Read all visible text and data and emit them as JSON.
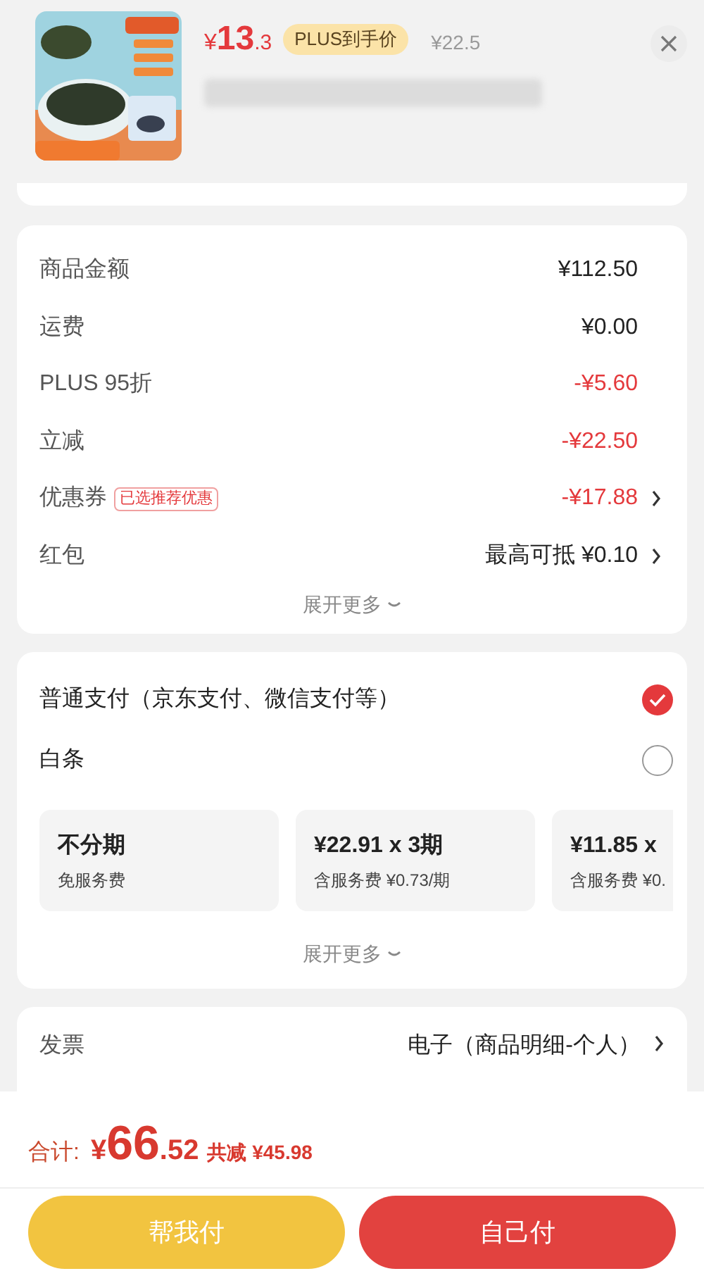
{
  "product": {
    "currency": "¥",
    "price_int": "13",
    "price_dec": ".3",
    "badge": "PLUS到手价",
    "original_price": "¥22.5"
  },
  "summary": {
    "rows": [
      {
        "label": "商品金额",
        "value": "¥112.50",
        "discount": false,
        "arrow": false
      },
      {
        "label": "运费",
        "value": "¥0.00",
        "discount": false,
        "arrow": false
      },
      {
        "label": "PLUS 95折",
        "value": "-¥5.60",
        "discount": true,
        "arrow": false
      },
      {
        "label": "立减",
        "value": "-¥22.50",
        "discount": true,
        "arrow": false
      },
      {
        "label": "优惠券",
        "tag": "已选推荐优惠",
        "value": "-¥17.88",
        "discount": true,
        "arrow": true
      },
      {
        "label": "红包",
        "value": "最高可抵 ¥0.10",
        "discount": false,
        "arrow": true
      }
    ],
    "expand": "展开更多"
  },
  "payment": {
    "options": [
      {
        "label": "普通支付（京东支付、微信支付等）",
        "selected": true
      },
      {
        "label": "白条",
        "selected": false
      }
    ],
    "installments": [
      {
        "title": "不分期",
        "subtitle": "免服务费"
      },
      {
        "title": "¥22.91 x 3期",
        "subtitle": "含服务费 ¥0.73/期"
      },
      {
        "title": "¥11.85 x",
        "subtitle": "含服务费 ¥0."
      }
    ],
    "expand": "展开更多"
  },
  "invoice": {
    "label": "发票",
    "value": "电子（商品明细-个人）"
  },
  "footer": {
    "total_label": "合计:",
    "currency": "¥",
    "total_int": "66",
    "total_dec": ".52",
    "saved": "共减 ¥45.98",
    "buttons": [
      {
        "label": "帮我付",
        "kind": "secondary"
      },
      {
        "label": "自己付",
        "kind": "primary"
      }
    ]
  }
}
